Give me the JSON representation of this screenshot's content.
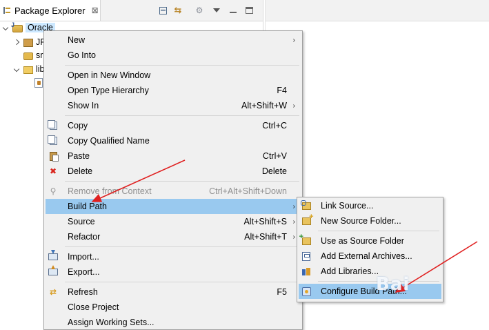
{
  "view": {
    "title": "Package Explorer",
    "close_glyph": "⊠"
  },
  "tree": {
    "oracle": "Oracle",
    "jre": "JR",
    "src": "sr",
    "lib": "lib"
  },
  "menu": {
    "items": [
      {
        "label": "New",
        "accelerator": "",
        "submenu": true
      },
      {
        "label": "Go Into",
        "accelerator": "",
        "submenu": false
      },
      {
        "label": "Open in New Window",
        "accelerator": "",
        "submenu": false
      },
      {
        "label": "Open Type Hierarchy",
        "accelerator": "F4",
        "submenu": false
      },
      {
        "label": "Show In",
        "accelerator": "Alt+Shift+W",
        "submenu": true
      },
      {
        "label": "Copy",
        "accelerator": "Ctrl+C",
        "submenu": false
      },
      {
        "label": "Copy Qualified Name",
        "accelerator": "",
        "submenu": false
      },
      {
        "label": "Paste",
        "accelerator": "Ctrl+V",
        "submenu": false
      },
      {
        "label": "Delete",
        "accelerator": "Delete",
        "submenu": false
      },
      {
        "label": "Remove from Context",
        "accelerator": "Ctrl+Alt+Shift+Down",
        "submenu": false,
        "disabled": true
      },
      {
        "label": "Build Path",
        "accelerator": "",
        "submenu": true,
        "highlighted": true
      },
      {
        "label": "Source",
        "accelerator": "Alt+Shift+S",
        "submenu": true
      },
      {
        "label": "Refactor",
        "accelerator": "Alt+Shift+T",
        "submenu": true
      },
      {
        "label": "Import...",
        "accelerator": "",
        "submenu": false
      },
      {
        "label": "Export...",
        "accelerator": "",
        "submenu": false
      },
      {
        "label": "Refresh",
        "accelerator": "F5",
        "submenu": false
      },
      {
        "label": "Close Project",
        "accelerator": "",
        "submenu": false
      },
      {
        "label": "Assign Working Sets...",
        "accelerator": "",
        "submenu": false
      }
    ]
  },
  "submenu": {
    "items": [
      {
        "label": "Link Source..."
      },
      {
        "label": "New Source Folder..."
      },
      {
        "label": "Use as Source Folder"
      },
      {
        "label": "Add External Archives..."
      },
      {
        "label": "Add Libraries..."
      },
      {
        "label": "Configure Build Path...",
        "highlighted": true
      }
    ]
  },
  "arrow_glyph": "›",
  "watermark": "Bai",
  "colors": {
    "highlight": "#99c9ef",
    "menu_bg": "#f0f0f0",
    "annotation_arrow": "#e02020",
    "tree_selection": "#cce8ff"
  }
}
